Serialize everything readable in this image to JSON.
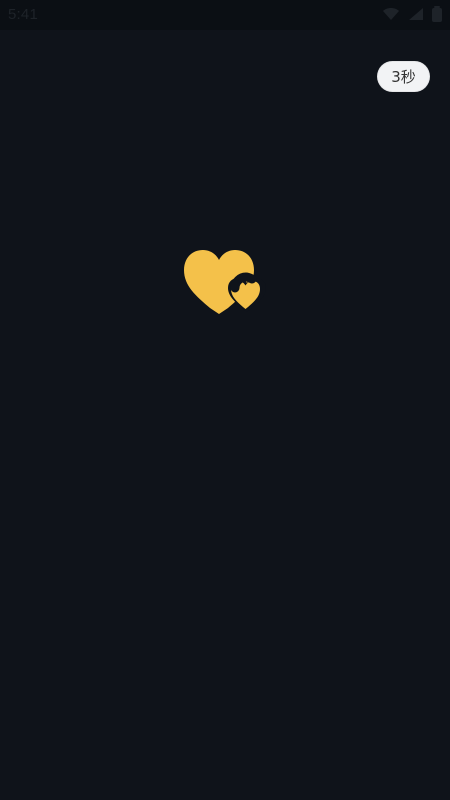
{
  "status_bar": {
    "time": "5:41",
    "icons": [
      "wifi-icon",
      "cellular-icon",
      "battery-icon"
    ]
  },
  "splash": {
    "skip_label": "3秒",
    "logo_icon": "double-heart-icon",
    "colors": {
      "background": "#0f131a",
      "logo": "#f4c14a",
      "skip_bg": "#f2f3f5",
      "skip_text": "#333333"
    }
  }
}
